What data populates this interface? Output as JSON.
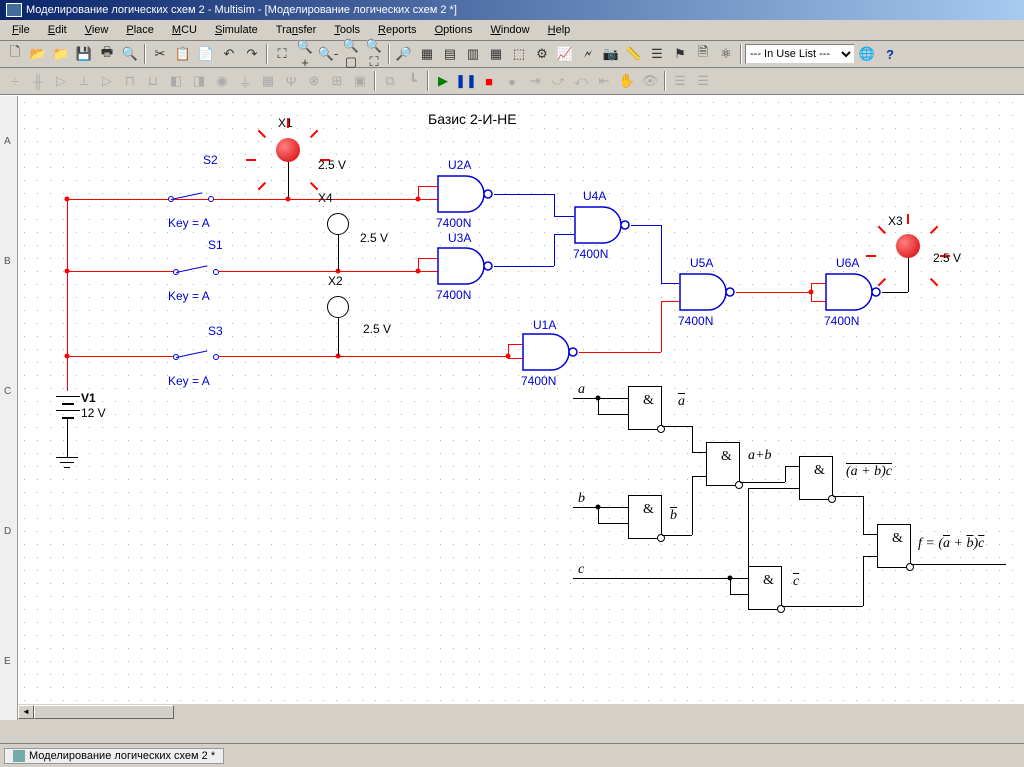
{
  "title": "Моделирование логических схем 2 - Multisim - [Моделирование логических схем 2 *]",
  "menus": [
    "File",
    "Edit",
    "View",
    "Place",
    "MCU",
    "Simulate",
    "Transfer",
    "Tools",
    "Reports",
    "Options",
    "Window",
    "Help"
  ],
  "dropdown_tb": "--- In Use List ---",
  "tab_name": "Моделирование логических схем 2 *",
  "ruler": [
    "A",
    "B",
    "C",
    "D",
    "E"
  ],
  "circuit": {
    "title": "Базис 2-И-НЕ",
    "switches": {
      "s1": {
        "label": "S1",
        "key": "Key = A"
      },
      "s2": {
        "label": "S2",
        "key": "Key = A"
      },
      "s3": {
        "label": "S3",
        "key": "Key = A"
      }
    },
    "probes": {
      "x1": {
        "label": "X1",
        "voltage": "2.5 V"
      },
      "x2": {
        "label": "X2",
        "voltage": "2.5 V"
      },
      "x3": {
        "label": "X3",
        "voltage": "2.5 V"
      },
      "x4": {
        "label": "X4",
        "voltage": "2.5 V"
      }
    },
    "gates": {
      "u1": {
        "label": "U1A",
        "part": "7400N"
      },
      "u2": {
        "label": "U2A",
        "part": "7400N"
      },
      "u3": {
        "label": "U3A",
        "part": "7400N"
      },
      "u4": {
        "label": "U4A",
        "part": "7400N"
      },
      "u5": {
        "label": "U5A",
        "part": "7400N"
      },
      "u6": {
        "label": "U6A",
        "part": "7400N"
      }
    },
    "source": {
      "label": "V1",
      "value": "12 V"
    }
  },
  "logic_diagram": {
    "inputs": [
      "a",
      "b",
      "c"
    ],
    "op": "&",
    "nodes": {
      "na": "a",
      "nb": "b",
      "nc": "c",
      "apb": "a+b",
      "apbc": "(a + b)c"
    },
    "output": "f = (a + b)c"
  }
}
